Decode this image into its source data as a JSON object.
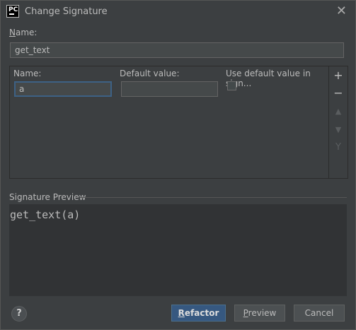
{
  "window": {
    "title": "Change Signature",
    "app_icon_text": "PC"
  },
  "name_field": {
    "label_mnemonic": "N",
    "label_rest": "ame:",
    "value": "get_text"
  },
  "params": {
    "columns": {
      "name": "Name:",
      "default": "Default value:",
      "use_default": "Use default value in sign..."
    },
    "rows": [
      {
        "name": "a",
        "default": ""
      }
    ],
    "toolbar": [
      "add-icon",
      "remove-icon",
      "move-up-icon",
      "move-down-icon",
      "propagate-icon"
    ]
  },
  "preview": {
    "title": "Signature Preview",
    "text": "get_text(a)"
  },
  "footer": {
    "help": "?",
    "refactor_mnemonic": "R",
    "refactor_rest": "efactor",
    "preview_mnemonic": "P",
    "preview_rest": "review",
    "cancel": "Cancel"
  }
}
